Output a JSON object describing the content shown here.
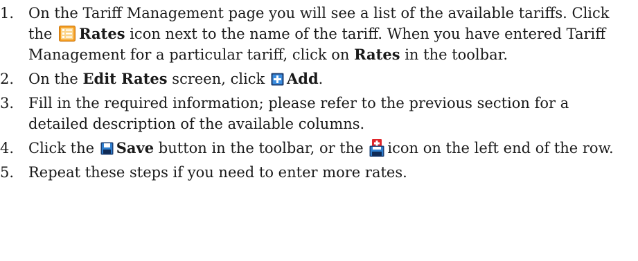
{
  "steps": [
    {
      "num": "1.",
      "part1": "On the Tariff Management page you will see a list of the available tariffs. Click the",
      "icon": "rates-list-icon",
      "bold1": "Rates",
      "part2": "icon next to the name of the tariff. When you have entered Tariff Management for a particular tariff, click on",
      "bold2": "Rates",
      "part3": "in the toolbar."
    },
    {
      "num": "2.",
      "part1": "On the",
      "bold1": "Edit Rates",
      "part2": "screen, click",
      "icon": "add-icon",
      "bold2": "Add",
      "part3": "."
    },
    {
      "num": "3.",
      "text": "Fill in the required information; please refer to the previous section for a detailed description of the available columns."
    },
    {
      "num": "4.",
      "part1": "Click the",
      "icon1": "save-icon",
      "bold1": "Save",
      "part2": "button in the toolbar, or the",
      "icon2": "save-row-icon",
      "part3": "icon on the left end of the row."
    },
    {
      "num": "5.",
      "text": "Repeat these steps if you need to enter more rates."
    }
  ],
  "colors": {
    "icon_orange": "#f29a1e",
    "icon_blue": "#1f6fb8",
    "icon_navy": "#1d3f73",
    "icon_red": "#e0262b"
  }
}
